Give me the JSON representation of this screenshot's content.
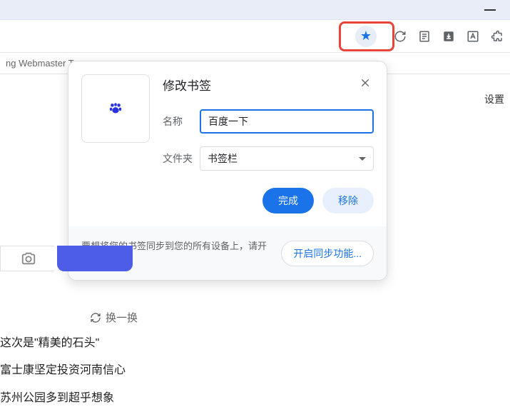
{
  "tab_text": "ng Webmaster T",
  "settings_label": "设置",
  "dialog": {
    "title": "修改书签",
    "name_label": "名称",
    "name_value": "百度一下",
    "folder_label": "文件夹",
    "folder_value": "书签栏",
    "done_button": "完成",
    "remove_button": "移除"
  },
  "sync": {
    "hint": "要想将您的书签同步到您的所有设备上，请开启同步功能。",
    "button": "开启同步功能..."
  },
  "refresh_label": "换一换",
  "news": {
    "item1": "这次是\"精美的石头\"",
    "item2": "富士康坚定投资河南信心",
    "item3": "苏州公园多到超乎想象"
  }
}
